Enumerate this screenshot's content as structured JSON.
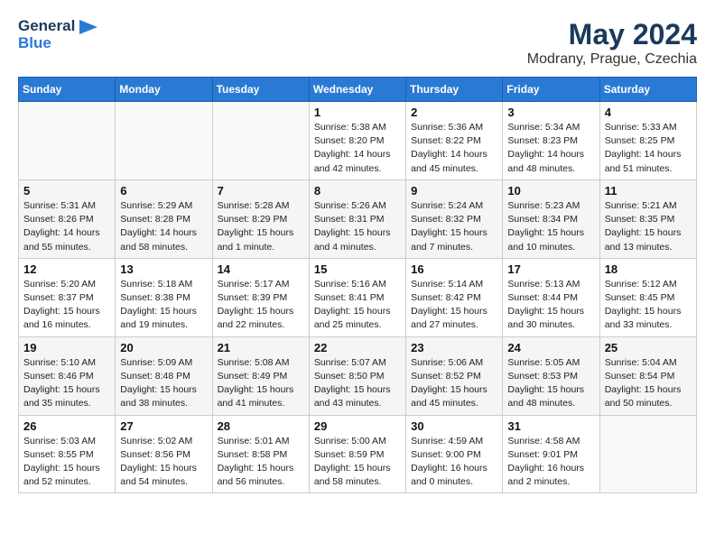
{
  "header": {
    "logo_line1": "General",
    "logo_line2": "Blue",
    "title": "May 2024",
    "subtitle": "Modrany, Prague, Czechia"
  },
  "days_of_week": [
    "Sunday",
    "Monday",
    "Tuesday",
    "Wednesday",
    "Thursday",
    "Friday",
    "Saturday"
  ],
  "weeks": [
    [
      {
        "day": "",
        "info": ""
      },
      {
        "day": "",
        "info": ""
      },
      {
        "day": "",
        "info": ""
      },
      {
        "day": "1",
        "info": "Sunrise: 5:38 AM\nSunset: 8:20 PM\nDaylight: 14 hours\nand 42 minutes."
      },
      {
        "day": "2",
        "info": "Sunrise: 5:36 AM\nSunset: 8:22 PM\nDaylight: 14 hours\nand 45 minutes."
      },
      {
        "day": "3",
        "info": "Sunrise: 5:34 AM\nSunset: 8:23 PM\nDaylight: 14 hours\nand 48 minutes."
      },
      {
        "day": "4",
        "info": "Sunrise: 5:33 AM\nSunset: 8:25 PM\nDaylight: 14 hours\nand 51 minutes."
      }
    ],
    [
      {
        "day": "5",
        "info": "Sunrise: 5:31 AM\nSunset: 8:26 PM\nDaylight: 14 hours\nand 55 minutes."
      },
      {
        "day": "6",
        "info": "Sunrise: 5:29 AM\nSunset: 8:28 PM\nDaylight: 14 hours\nand 58 minutes."
      },
      {
        "day": "7",
        "info": "Sunrise: 5:28 AM\nSunset: 8:29 PM\nDaylight: 15 hours\nand 1 minute."
      },
      {
        "day": "8",
        "info": "Sunrise: 5:26 AM\nSunset: 8:31 PM\nDaylight: 15 hours\nand 4 minutes."
      },
      {
        "day": "9",
        "info": "Sunrise: 5:24 AM\nSunset: 8:32 PM\nDaylight: 15 hours\nand 7 minutes."
      },
      {
        "day": "10",
        "info": "Sunrise: 5:23 AM\nSunset: 8:34 PM\nDaylight: 15 hours\nand 10 minutes."
      },
      {
        "day": "11",
        "info": "Sunrise: 5:21 AM\nSunset: 8:35 PM\nDaylight: 15 hours\nand 13 minutes."
      }
    ],
    [
      {
        "day": "12",
        "info": "Sunrise: 5:20 AM\nSunset: 8:37 PM\nDaylight: 15 hours\nand 16 minutes."
      },
      {
        "day": "13",
        "info": "Sunrise: 5:18 AM\nSunset: 8:38 PM\nDaylight: 15 hours\nand 19 minutes."
      },
      {
        "day": "14",
        "info": "Sunrise: 5:17 AM\nSunset: 8:39 PM\nDaylight: 15 hours\nand 22 minutes."
      },
      {
        "day": "15",
        "info": "Sunrise: 5:16 AM\nSunset: 8:41 PM\nDaylight: 15 hours\nand 25 minutes."
      },
      {
        "day": "16",
        "info": "Sunrise: 5:14 AM\nSunset: 8:42 PM\nDaylight: 15 hours\nand 27 minutes."
      },
      {
        "day": "17",
        "info": "Sunrise: 5:13 AM\nSunset: 8:44 PM\nDaylight: 15 hours\nand 30 minutes."
      },
      {
        "day": "18",
        "info": "Sunrise: 5:12 AM\nSunset: 8:45 PM\nDaylight: 15 hours\nand 33 minutes."
      }
    ],
    [
      {
        "day": "19",
        "info": "Sunrise: 5:10 AM\nSunset: 8:46 PM\nDaylight: 15 hours\nand 35 minutes."
      },
      {
        "day": "20",
        "info": "Sunrise: 5:09 AM\nSunset: 8:48 PM\nDaylight: 15 hours\nand 38 minutes."
      },
      {
        "day": "21",
        "info": "Sunrise: 5:08 AM\nSunset: 8:49 PM\nDaylight: 15 hours\nand 41 minutes."
      },
      {
        "day": "22",
        "info": "Sunrise: 5:07 AM\nSunset: 8:50 PM\nDaylight: 15 hours\nand 43 minutes."
      },
      {
        "day": "23",
        "info": "Sunrise: 5:06 AM\nSunset: 8:52 PM\nDaylight: 15 hours\nand 45 minutes."
      },
      {
        "day": "24",
        "info": "Sunrise: 5:05 AM\nSunset: 8:53 PM\nDaylight: 15 hours\nand 48 minutes."
      },
      {
        "day": "25",
        "info": "Sunrise: 5:04 AM\nSunset: 8:54 PM\nDaylight: 15 hours\nand 50 minutes."
      }
    ],
    [
      {
        "day": "26",
        "info": "Sunrise: 5:03 AM\nSunset: 8:55 PM\nDaylight: 15 hours\nand 52 minutes."
      },
      {
        "day": "27",
        "info": "Sunrise: 5:02 AM\nSunset: 8:56 PM\nDaylight: 15 hours\nand 54 minutes."
      },
      {
        "day": "28",
        "info": "Sunrise: 5:01 AM\nSunset: 8:58 PM\nDaylight: 15 hours\nand 56 minutes."
      },
      {
        "day": "29",
        "info": "Sunrise: 5:00 AM\nSunset: 8:59 PM\nDaylight: 15 hours\nand 58 minutes."
      },
      {
        "day": "30",
        "info": "Sunrise: 4:59 AM\nSunset: 9:00 PM\nDaylight: 16 hours\nand 0 minutes."
      },
      {
        "day": "31",
        "info": "Sunrise: 4:58 AM\nSunset: 9:01 PM\nDaylight: 16 hours\nand 2 minutes."
      },
      {
        "day": "",
        "info": ""
      }
    ]
  ]
}
